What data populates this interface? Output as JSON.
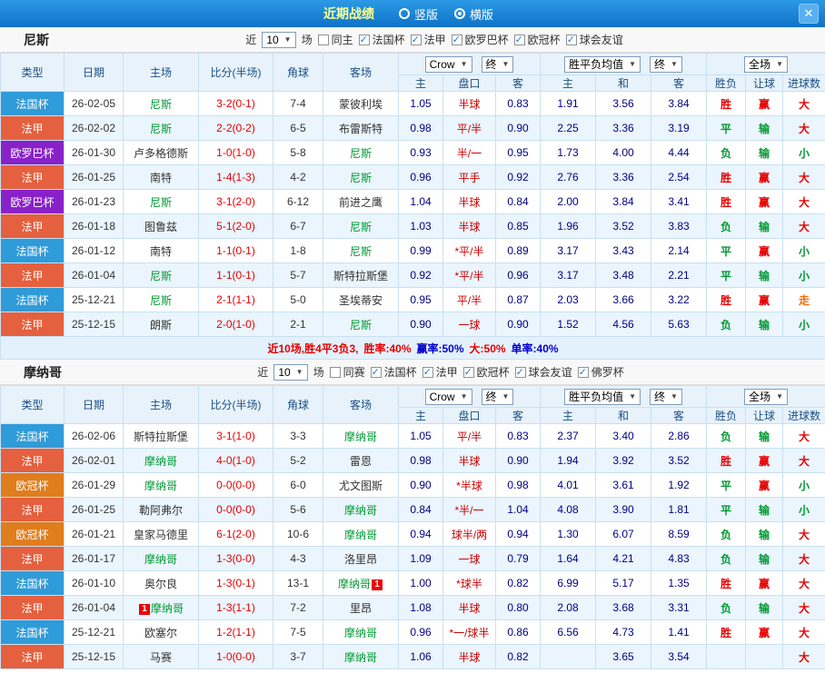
{
  "titlebar": {
    "title": "近期战绩",
    "view_options": [
      {
        "label": "竖版",
        "selected": false
      },
      {
        "label": "横版",
        "selected": true
      }
    ],
    "close": "✕"
  },
  "table_config": {
    "main_columns": [
      "类型",
      "日期",
      "主场",
      "比分(半场)",
      "角球",
      "客场"
    ],
    "odds_sub_columns": [
      "主",
      "盘口",
      "客"
    ],
    "avg_sub_columns": [
      "主",
      "和",
      "客"
    ],
    "result_sub_columns": [
      "胜负",
      "让球",
      "进球数"
    ],
    "bookmaker_select": "Crow",
    "odds_final_select": "终",
    "avg_select": "胜平负均值",
    "avg_final_select": "终",
    "scope_select": "全场"
  },
  "palette": {
    "type_colors": {
      "法国杯": "#2f9bd8",
      "法甲": "#e5603e",
      "欧罗巴杯": "#8921c9",
      "欧冠杯": "#e07d1d"
    },
    "result_colors": {
      "胜": "#e60000",
      "平": "#009933",
      "负": "#009933",
      "赢": "#e60000",
      "输": "#009933",
      "大": "#e60000",
      "小": "#009933",
      "走": "#ff6600"
    }
  },
  "sections": [
    {
      "team": "尼斯",
      "filter": {
        "prefix": "近",
        "count": "10",
        "suffix": "场",
        "checkboxes": [
          {
            "label": "同主",
            "checked": false
          },
          {
            "label": "法国杯",
            "checked": true
          },
          {
            "label": "法甲",
            "checked": true
          },
          {
            "label": "欧罗巴杯",
            "checked": true
          },
          {
            "label": "欧冠杯",
            "checked": true
          },
          {
            "label": "球会友谊",
            "checked": true
          }
        ]
      },
      "rows": [
        {
          "type": "法国杯",
          "date": "26-02-05",
          "home": "尼斯",
          "home_is_team": true,
          "score": "3-2(0-1)",
          "corners": "7-4",
          "away": "蒙彼利埃",
          "away_is_team": false,
          "odds": [
            "1.05",
            "半球",
            "0.83"
          ],
          "avg": [
            "1.91",
            "3.56",
            "3.84"
          ],
          "result": [
            "胜",
            "赢",
            "大"
          ]
        },
        {
          "type": "法甲",
          "date": "26-02-02",
          "home": "尼斯",
          "home_is_team": true,
          "score": "2-2(0-2)",
          "corners": "6-5",
          "away": "布雷斯特",
          "away_is_team": false,
          "odds": [
            "0.98",
            "平/半",
            "0.90"
          ],
          "avg": [
            "2.25",
            "3.36",
            "3.19"
          ],
          "result": [
            "平",
            "输",
            "大"
          ]
        },
        {
          "type": "欧罗巴杯",
          "date": "26-01-30",
          "home": "卢多格德斯",
          "home_is_team": false,
          "score": "1-0(1-0)",
          "corners": "5-8",
          "away": "尼斯",
          "away_is_team": true,
          "odds": [
            "0.93",
            "半/一",
            "0.95"
          ],
          "avg": [
            "1.73",
            "4.00",
            "4.44"
          ],
          "result": [
            "负",
            "输",
            "小"
          ]
        },
        {
          "type": "法甲",
          "date": "26-01-25",
          "home": "南特",
          "home_is_team": false,
          "score": "1-4(1-3)",
          "corners": "4-2",
          "away": "尼斯",
          "away_is_team": true,
          "odds": [
            "0.96",
            "平手",
            "0.92"
          ],
          "avg": [
            "2.76",
            "3.36",
            "2.54"
          ],
          "result": [
            "胜",
            "赢",
            "大"
          ]
        },
        {
          "type": "欧罗巴杯",
          "date": "26-01-23",
          "home": "尼斯",
          "home_is_team": true,
          "score": "3-1(2-0)",
          "corners": "6-12",
          "away": "前进之鹰",
          "away_is_team": false,
          "odds": [
            "1.04",
            "半球",
            "0.84"
          ],
          "avg": [
            "2.00",
            "3.84",
            "3.41"
          ],
          "result": [
            "胜",
            "赢",
            "大"
          ]
        },
        {
          "type": "法甲",
          "date": "26-01-18",
          "home": "图鲁兹",
          "home_is_team": false,
          "score": "5-1(2-0)",
          "corners": "6-7",
          "away": "尼斯",
          "away_is_team": true,
          "odds": [
            "1.03",
            "半球",
            "0.85"
          ],
          "avg": [
            "1.96",
            "3.52",
            "3.83"
          ],
          "result": [
            "负",
            "输",
            "大"
          ]
        },
        {
          "type": "法国杯",
          "date": "26-01-12",
          "home": "南特",
          "home_is_team": false,
          "score": "1-1(0-1)",
          "corners": "1-8",
          "away": "尼斯",
          "away_is_team": true,
          "odds": [
            "0.99",
            "*平/半",
            "0.89"
          ],
          "avg": [
            "3.17",
            "3.43",
            "2.14"
          ],
          "result": [
            "平",
            "赢",
            "小"
          ]
        },
        {
          "type": "法甲",
          "date": "26-01-04",
          "home": "尼斯",
          "home_is_team": true,
          "score": "1-1(0-1)",
          "corners": "5-7",
          "away": "斯特拉斯堡",
          "away_is_team": false,
          "odds": [
            "0.92",
            "*平/半",
            "0.96"
          ],
          "avg": [
            "3.17",
            "3.48",
            "2.21"
          ],
          "result": [
            "平",
            "输",
            "小"
          ]
        },
        {
          "type": "法国杯",
          "date": "25-12-21",
          "home": "尼斯",
          "home_is_team": true,
          "score": "2-1(1-1)",
          "corners": "5-0",
          "away": "圣埃蒂安",
          "away_is_team": false,
          "odds": [
            "0.95",
            "平/半",
            "0.87"
          ],
          "avg": [
            "2.03",
            "3.66",
            "3.22"
          ],
          "result": [
            "胜",
            "赢",
            "走"
          ]
        },
        {
          "type": "法甲",
          "date": "25-12-15",
          "home": "朗斯",
          "home_is_team": false,
          "score": "2-0(1-0)",
          "corners": "2-1",
          "away": "尼斯",
          "away_is_team": true,
          "odds": [
            "0.90",
            "一球",
            "0.90"
          ],
          "avg": [
            "1.52",
            "4.56",
            "5.63"
          ],
          "result": [
            "负",
            "输",
            "小"
          ]
        }
      ],
      "summary": [
        {
          "text": "近10场,胜4平3负3,",
          "color": "#e60000"
        },
        {
          "text": "胜率:40%",
          "color": "#e60000"
        },
        {
          "text": "赢率:50%",
          "color": "#0000cc"
        },
        {
          "text": "大:50%",
          "color": "#e60000"
        },
        {
          "text": "单率:40%",
          "color": "#0000cc"
        }
      ]
    },
    {
      "team": "摩纳哥",
      "filter": {
        "prefix": "近",
        "count": "10",
        "suffix": "场",
        "checkboxes": [
          {
            "label": "同赛",
            "checked": false
          },
          {
            "label": "法国杯",
            "checked": true
          },
          {
            "label": "法甲",
            "checked": true
          },
          {
            "label": "欧冠杯",
            "checked": true
          },
          {
            "label": "球会友谊",
            "checked": true
          },
          {
            "label": "佛罗杯",
            "checked": true
          }
        ]
      },
      "rows": [
        {
          "type": "法国杯",
          "date": "26-02-06",
          "home": "斯特拉斯堡",
          "home_is_team": false,
          "score": "3-1(1-0)",
          "corners": "3-3",
          "away": "摩纳哥",
          "away_is_team": true,
          "odds": [
            "1.05",
            "平/半",
            "0.83"
          ],
          "avg": [
            "2.37",
            "3.40",
            "2.86"
          ],
          "result": [
            "负",
            "输",
            "大"
          ]
        },
        {
          "type": "法甲",
          "date": "26-02-01",
          "home": "摩纳哥",
          "home_is_team": true,
          "score": "4-0(1-0)",
          "corners": "5-2",
          "away": "雷恩",
          "away_is_team": false,
          "odds": [
            "0.98",
            "半球",
            "0.90"
          ],
          "avg": [
            "1.94",
            "3.92",
            "3.52"
          ],
          "result": [
            "胜",
            "赢",
            "大"
          ]
        },
        {
          "type": "欧冠杯",
          "date": "26-01-29",
          "home": "摩纳哥",
          "home_is_team": true,
          "score": "0-0(0-0)",
          "corners": "6-0",
          "away": "尤文图斯",
          "away_is_team": false,
          "odds": [
            "0.90",
            "*半球",
            "0.98"
          ],
          "avg": [
            "4.01",
            "3.61",
            "1.92"
          ],
          "result": [
            "平",
            "赢",
            "小"
          ]
        },
        {
          "type": "法甲",
          "date": "26-01-25",
          "home": "勒阿弗尔",
          "home_is_team": false,
          "score": "0-0(0-0)",
          "corners": "5-6",
          "away": "摩纳哥",
          "away_is_team": true,
          "odds": [
            "0.84",
            "*半/一",
            "1.04"
          ],
          "avg": [
            "4.08",
            "3.90",
            "1.81"
          ],
          "result": [
            "平",
            "输",
            "小"
          ]
        },
        {
          "type": "欧冠杯",
          "date": "26-01-21",
          "home": "皇家马德里",
          "home_is_team": false,
          "score": "6-1(2-0)",
          "corners": "10-6",
          "away": "摩纳哥",
          "away_is_team": true,
          "odds": [
            "0.94",
            "球半/两",
            "0.94"
          ],
          "avg": [
            "1.30",
            "6.07",
            "8.59"
          ],
          "result": [
            "负",
            "输",
            "大"
          ]
        },
        {
          "type": "法甲",
          "date": "26-01-17",
          "home": "摩纳哥",
          "home_is_team": true,
          "score": "1-3(0-0)",
          "corners": "4-3",
          "away": "洛里昂",
          "away_is_team": false,
          "odds": [
            "1.09",
            "一球",
            "0.79"
          ],
          "avg": [
            "1.64",
            "4.21",
            "4.83"
          ],
          "result": [
            "负",
            "输",
            "大"
          ]
        },
        {
          "type": "法国杯",
          "date": "26-01-10",
          "home": "奥尔良",
          "home_is_team": false,
          "score": "1-3(0-1)",
          "corners": "13-1",
          "away": "摩纳哥",
          "away_is_team": true,
          "away_badge": {
            "text": "1",
            "pos": "after"
          },
          "odds": [
            "1.00",
            "*球半",
            "0.82"
          ],
          "avg": [
            "6.99",
            "5.17",
            "1.35"
          ],
          "result": [
            "胜",
            "赢",
            "大"
          ]
        },
        {
          "type": "法甲",
          "date": "26-01-04",
          "home": "摩纳哥",
          "home_is_team": true,
          "home_badge": {
            "text": "1",
            "pos": "before"
          },
          "score": "1-3(1-1)",
          "corners": "7-2",
          "away": "里昂",
          "away_is_team": false,
          "odds": [
            "1.08",
            "半球",
            "0.80"
          ],
          "avg": [
            "2.08",
            "3.68",
            "3.31"
          ],
          "result": [
            "负",
            "输",
            "大"
          ]
        },
        {
          "type": "法国杯",
          "date": "25-12-21",
          "home": "欧塞尔",
          "home_is_team": false,
          "score": "1-2(1-1)",
          "corners": "7-5",
          "away": "摩纳哥",
          "away_is_team": true,
          "odds": [
            "0.96",
            "*一/球半",
            "0.86"
          ],
          "avg": [
            "6.56",
            "4.73",
            "1.41"
          ],
          "result": [
            "胜",
            "赢",
            "大"
          ]
        },
        {
          "type": "法甲",
          "date": "25-12-15",
          "home": "马赛",
          "home_is_team": false,
          "score": "1-0(0-0)",
          "corners": "3-7",
          "away": "摩纳哥",
          "away_is_team": true,
          "odds": [
            "1.06",
            "半球",
            "0.82"
          ],
          "avg": [
            "",
            "3.65",
            "3.54"
          ],
          "result": [
            "",
            "",
            "大"
          ]
        }
      ],
      "summary": []
    }
  ]
}
